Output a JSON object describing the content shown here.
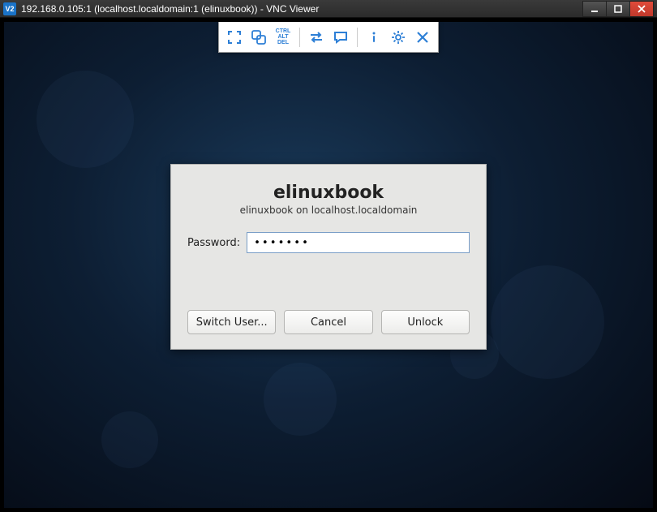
{
  "window": {
    "logo_text": "V2",
    "title": "192.168.0.105:1 (localhost.localdomain:1 (elinuxbook)) - VNC Viewer"
  },
  "vnc_toolbar": {
    "cad_label": "CTRL\nALT\nDEL"
  },
  "lock": {
    "username": "elinuxbook",
    "hostline": "elinuxbook on localhost.localdomain",
    "password_label": "Password:",
    "password_value": "•••••••",
    "switch_user_label": "Switch User...",
    "cancel_label": "Cancel",
    "unlock_label": "Unlock"
  }
}
